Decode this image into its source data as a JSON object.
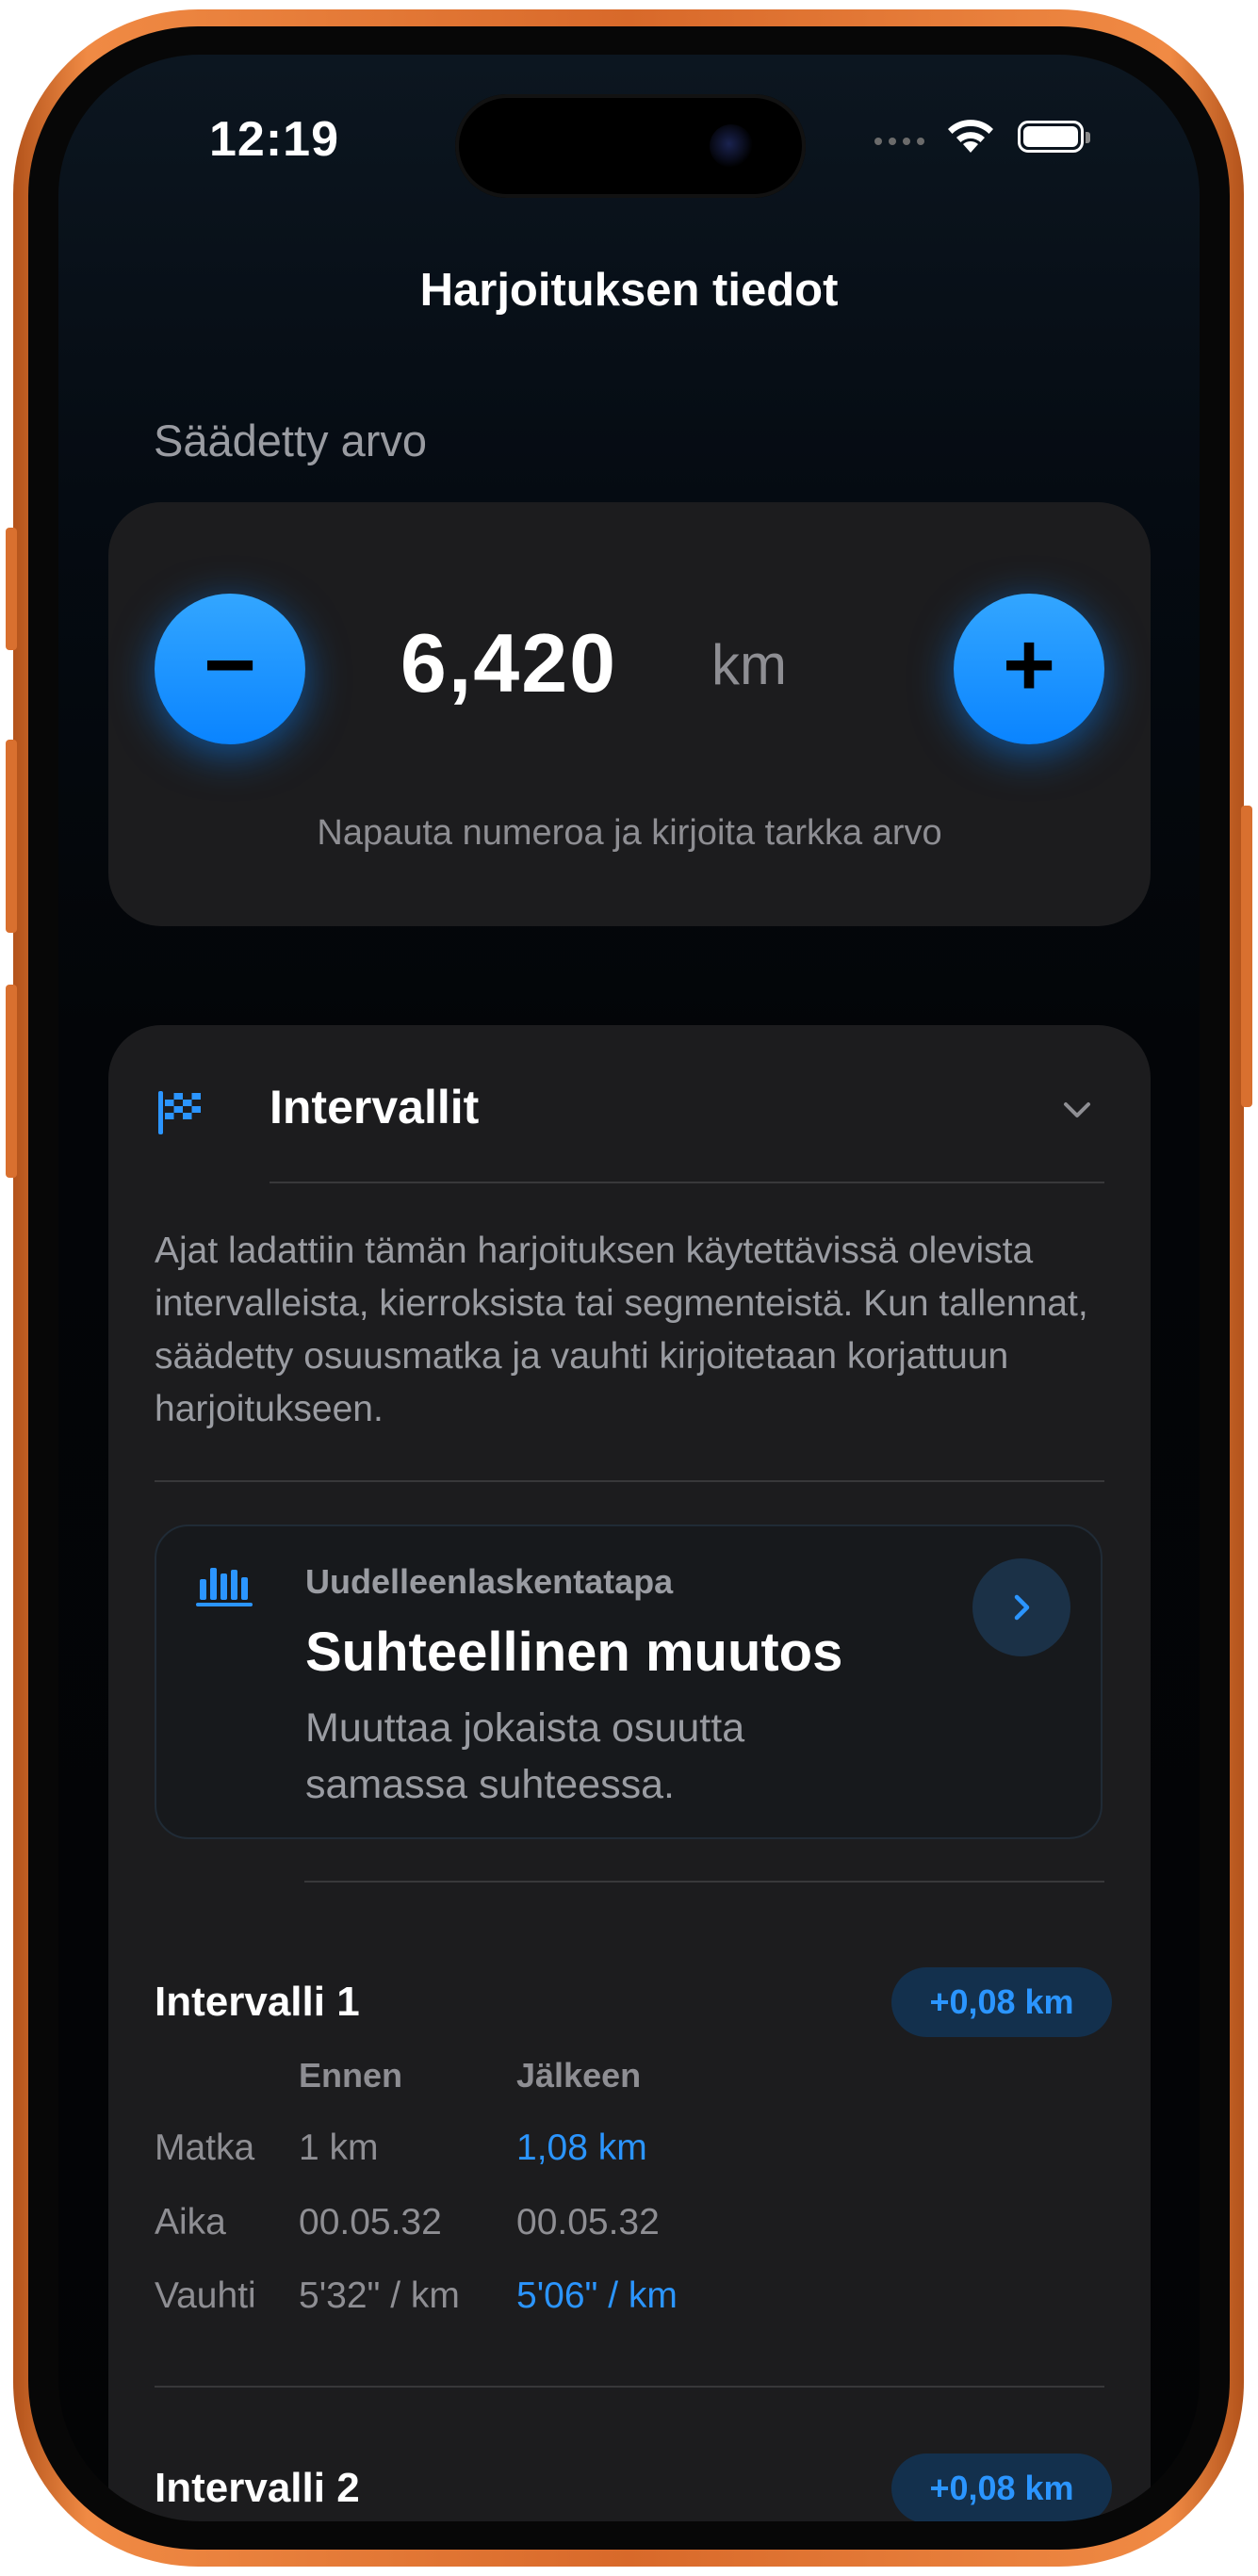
{
  "status_bar": {
    "time": "12:19"
  },
  "nav": {
    "title": "Harjoituksen tiedot"
  },
  "adjusted": {
    "section_label": "Säädetty arvo",
    "value": "6,420",
    "unit": "km",
    "minus_label": "−",
    "plus_label": "+",
    "hint": "Napauta numeroa ja kirjoita tarkka arvo"
  },
  "intervals": {
    "title": "Intervallit",
    "description": "Ajat ladattiin tämän harjoituksen käytettävissä olevista intervalleista, kierroksista tai segmenteistä. Kun tallennat, säädetty osuusmatka ja vauhti kirjoitetaan korjattuun harjoitukseen.",
    "method": {
      "label": "Uudelleenlaskentatapa",
      "title": "Suhteellinen muutos",
      "description": "Muuttaa jokaista osuutta samassa suhteessa."
    },
    "columns": {
      "before": "Ennen",
      "after": "Jälkeen"
    },
    "row_labels": {
      "distance": "Matka",
      "time": "Aika",
      "pace": "Vauhti"
    },
    "items": [
      {
        "title": "Intervalli 1",
        "badge": "+0,08 km",
        "distance_before": "1 km",
        "distance_after": "1,08 km",
        "time_before": "00.05.32",
        "time_after": "00.05.32",
        "pace_before": "5'32\" / km",
        "pace_after": "5'06\" / km"
      },
      {
        "title": "Intervalli 2",
        "badge": "+0,08 km"
      }
    ]
  },
  "colors": {
    "accent": "#0A84FF",
    "card_background": "#1C1C1E",
    "frame": "#E8773A"
  },
  "icons": {
    "flag": "checkered-flag-icon",
    "method": "bar-chart-icon",
    "expand": "chevron-down-icon",
    "arrow": "chevron-right-icon"
  }
}
